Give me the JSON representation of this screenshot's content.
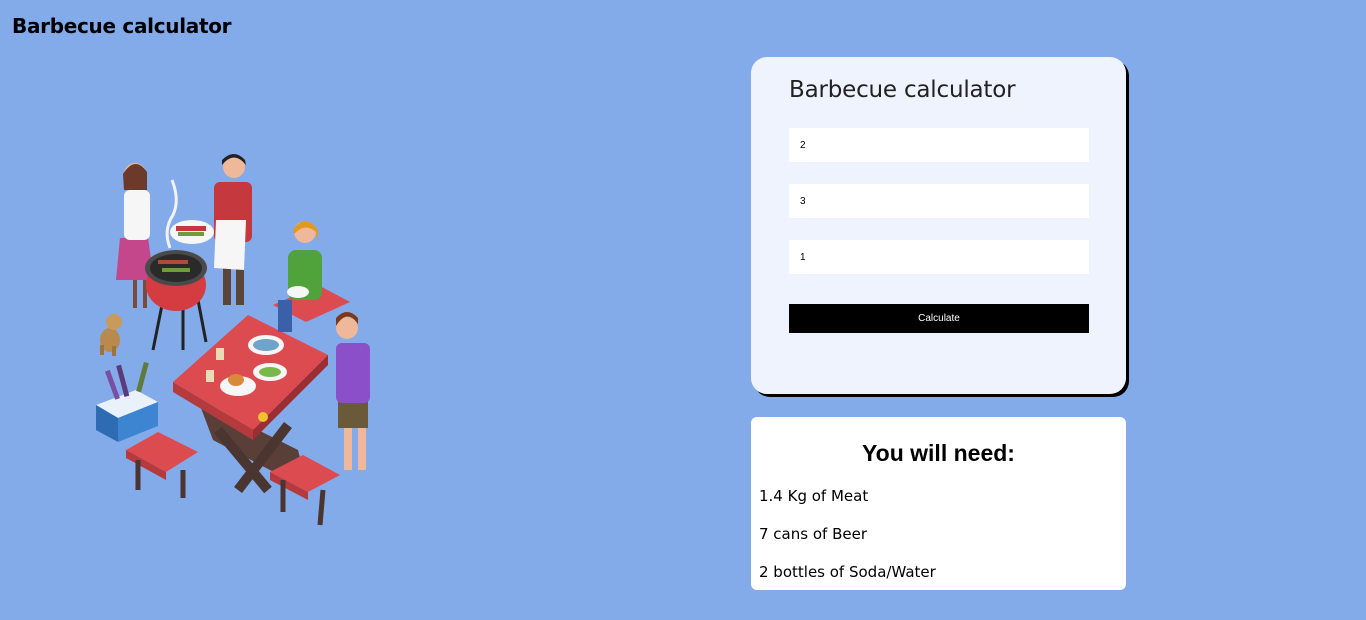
{
  "header": {
    "title": "Barbecue calculator"
  },
  "illustration": {
    "icon": "barbecue-party-illustration"
  },
  "calculator": {
    "title": "Barbecue calculator",
    "inputs": [
      {
        "name": "men",
        "value": "2"
      },
      {
        "name": "women",
        "value": "3"
      },
      {
        "name": "children",
        "value": "1"
      }
    ],
    "button_label": "Calculate"
  },
  "results": {
    "heading": "You will need:",
    "lines": [
      "1.4 Kg of Meat",
      "7 cans of Beer",
      "2 bottles of Soda/Water"
    ]
  },
  "colors": {
    "background": "#83aae9",
    "card": "#eef3fd",
    "button": "#000000"
  }
}
